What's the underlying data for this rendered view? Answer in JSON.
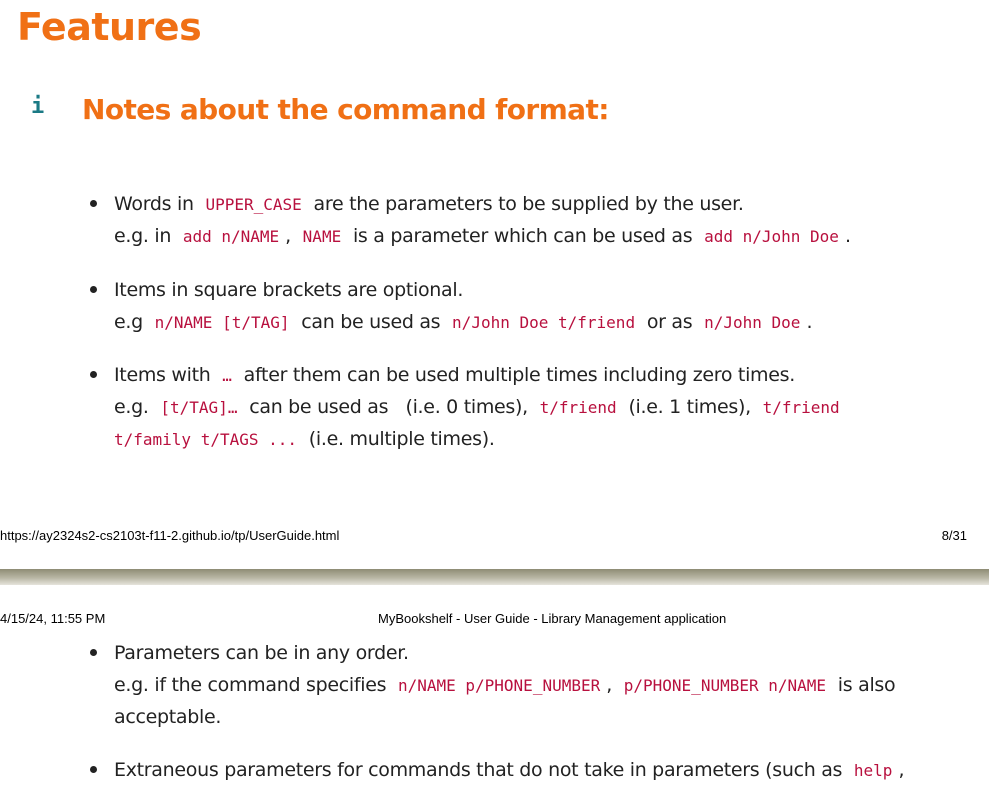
{
  "section_title": "Features",
  "note": {
    "icon": "info-icon",
    "icon_glyph": "i",
    "title": "Notes about the command format:"
  },
  "bullets": [
    {
      "l1_a": "Words in",
      "l1_code1": "UPPER_CASE",
      "l1_b": "are the parameters to be supplied by the user.",
      "l2_a": "e.g. in",
      "l2_code1": "add n/NAME",
      "l2_b": ",",
      "l2_code2": "NAME",
      "l2_c": "is a parameter which can be used as",
      "l2_code3": "add n/John Doe",
      "l2_d": "."
    },
    {
      "l1_a": "Items in square brackets are optional.",
      "l2_a": "e.g",
      "l2_code1": "n/NAME [t/TAG]",
      "l2_b": "can be used as",
      "l2_code2": "n/John Doe t/friend",
      "l2_c": "or as",
      "l2_code3": "n/John Doe",
      "l2_d": "."
    },
    {
      "l1_a": "Items with",
      "l1_code1": "…",
      "l1_b": "after them can be used multiple times including zero times.",
      "l2_a": "e.g.",
      "l2_code1": "[t/TAG]…",
      "l2_b": "can be used as",
      "l2_c": "(i.e. 0 times),",
      "l2_code2": "t/friend",
      "l2_d": "(i.e. 1 times),",
      "l2_code3": "t/friend",
      "l3_code1": "t/family t/TAGS ...",
      "l3_a": "(i.e. multiple times)."
    },
    {
      "l1_a": "Parameters can be in any order.",
      "l2_a": "e.g. if the command specifies",
      "l2_code1": "n/NAME p/PHONE_NUMBER",
      "l2_b": ",",
      "l2_code2": "p/PHONE_NUMBER n/NAME",
      "l2_c": "is also",
      "l3_a": "acceptable."
    },
    {
      "l1_a": "Extraneous parameters for commands that do not take in parameters (such as",
      "l1_code1": "help",
      "l1_b": ","
    }
  ],
  "footer": {
    "url": "https://ay2324s2-cs2103t-f11-2.github.io/tp/UserGuide.html",
    "page": "8/31"
  },
  "header": {
    "date": "4/15/24, 11:55 PM",
    "title": "MyBookshelf - User Guide - Library Management application"
  },
  "colors": {
    "heading": "#f07015",
    "code": "#b8103e",
    "info_icon": "#1b7a85",
    "text": "#222222"
  }
}
